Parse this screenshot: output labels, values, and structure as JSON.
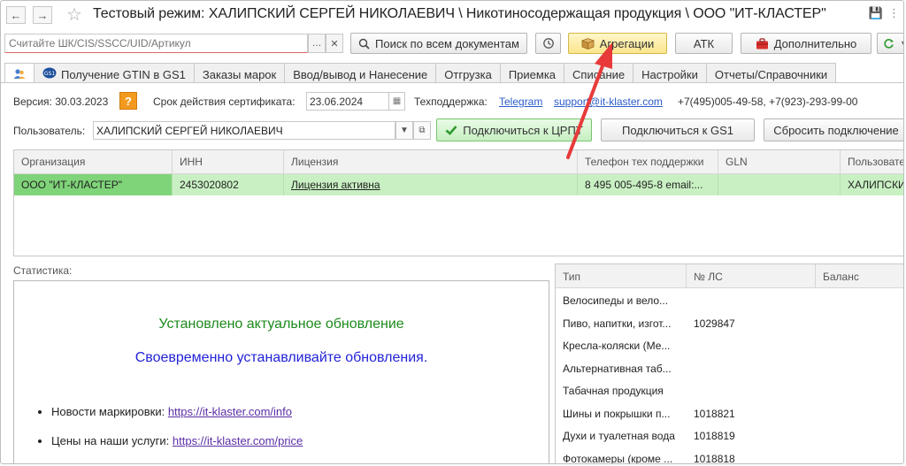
{
  "title": "Тестовый режим:  ХАЛИПСКИЙ СЕРГЕЙ НИКОЛАЕВИЧ \\ Никотиносодержащая продукция \\ ООО \"ИТ-КЛАСТЕР\"",
  "toolbar": {
    "scan_placeholder": "Считайте ШК/CIS/SSCC/UID/Артикул",
    "search_label": "Поиск по всем документам",
    "aggregation_label": "Агрегации",
    "atk_label": "АТК",
    "more_label": "Дополнительно"
  },
  "tabs": [
    {
      "label": ""
    },
    {
      "label": "Получение GTIN в GS1"
    },
    {
      "label": "Заказы марок"
    },
    {
      "label": "Ввод/вывод и Нанесение"
    },
    {
      "label": "Отгрузка"
    },
    {
      "label": "Приемка"
    },
    {
      "label": "Списание"
    },
    {
      "label": "Настройки"
    },
    {
      "label": "Отчеты/Справочники"
    }
  ],
  "info": {
    "version": "Версия: 30.03.2023",
    "question": "?",
    "cert_label": "Срок действия сертификата:",
    "cert_date": "23.06.2024",
    "support_label": "Техподдержка:",
    "telegram": "Telegram",
    "email": "support@it-klaster.com",
    "phones": "+7(495)005-49-58, +7(923)-293-99-00"
  },
  "user": {
    "label": "Пользователь:",
    "value": "ХАЛИПСКИЙ СЕРГЕЙ НИКОЛАЕВИЧ",
    "connect_crpt": "Подключиться к ЦРПТ",
    "connect_gs1": "Подключиться к GS1",
    "reset": "Сбросить подключение"
  },
  "grid": {
    "columns": [
      "Организация",
      "ИНН",
      "Лицензия",
      "Телефон тех поддержки",
      "GLN",
      "Пользовате"
    ],
    "row": [
      "ООО \"ИТ-КЛАСТЕР\"",
      "2453020802",
      "Лицензия активна",
      "8 495 005-495-8 email:...",
      "",
      "ХАЛИПСКИ"
    ]
  },
  "stats": {
    "label": "Статистика:",
    "msg1": "Установлено актуальное обновление",
    "msg2": "Своевременно устанавливайте обновления.",
    "bullets": [
      {
        "label": "Новости маркировки: ",
        "link": "https://it-klaster.com/info"
      },
      {
        "label": "Цены на наши услуги: ",
        "link": "https://it-klaster.com/price"
      }
    ]
  },
  "rtable": {
    "columns": [
      "Тип",
      "№ ЛС",
      "Баланс"
    ],
    "rows": [
      [
        "Велосипеды и вело...",
        "",
        ""
      ],
      [
        "Пиво, напитки, изгот...",
        "1029847",
        ""
      ],
      [
        "Кресла-коляски (Ме...",
        "",
        ""
      ],
      [
        "Альтернативная таб...",
        "",
        ""
      ],
      [
        "Табачная продукция",
        "",
        ""
      ],
      [
        "Шины и покрышки п...",
        "1018821",
        ""
      ],
      [
        "Духи и туалетная вода",
        "1018819",
        ""
      ],
      [
        "Фотокамеры (кроме ...",
        "1018818",
        ""
      ]
    ]
  },
  "colors": {
    "accent_arrow": "#e83a3a",
    "row_green": "#c9f0c3",
    "msg_green": "#1d8a1d",
    "msg_blue": "#2323d8"
  }
}
